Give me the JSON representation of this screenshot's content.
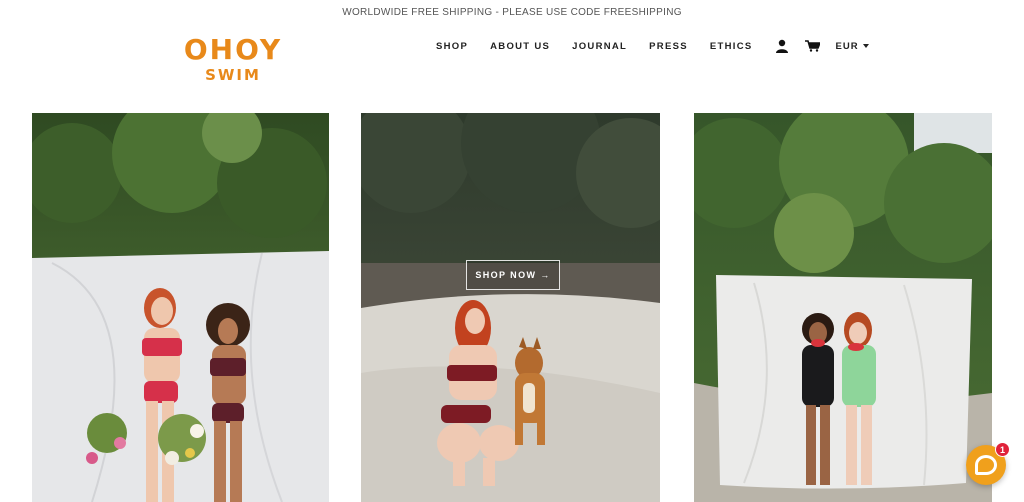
{
  "announcement": "WORLDWIDE FREE SHIPPING - PLEASE USE CODE FREESHIPPING",
  "brand": {
    "line1": "OHOY",
    "line2": "SWIM",
    "color": "#e8891a"
  },
  "nav": {
    "items": [
      "SHOP",
      "ABOUT US",
      "JOURNAL",
      "PRESS",
      "ETHICS"
    ],
    "account_icon": "user-icon",
    "cart_icon": "cart-icon",
    "currency": "EUR"
  },
  "hero": {
    "cta_label": "SHOP NOW →",
    "images": [
      "two-women-swimwear-flowers",
      "woman-with-dog-beach",
      "two-women-swimsuits-watermelon"
    ]
  },
  "chat": {
    "badge": "1",
    "icon": "chat-icon",
    "color": "#f0a01c"
  }
}
